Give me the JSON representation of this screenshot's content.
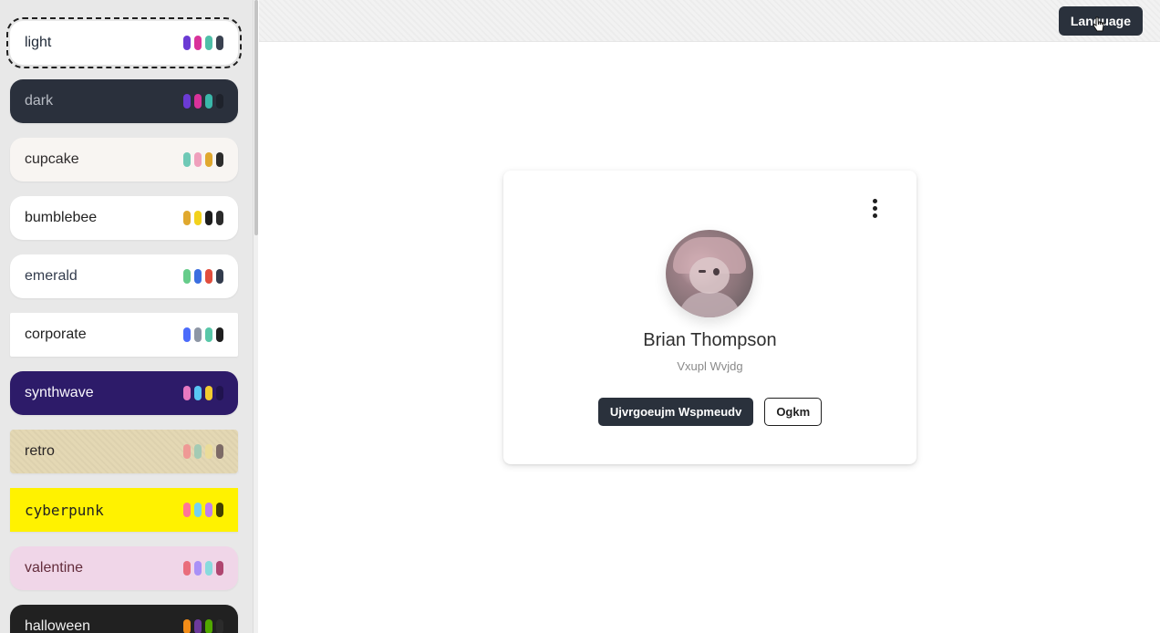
{
  "sidebar": {
    "themes": [
      {
        "label": "light",
        "bg": "#ffffff",
        "fg": "#1f2937",
        "swatches": [
          "#6b3bd4",
          "#d9329a",
          "#4fbfa8",
          "#3a4150"
        ]
      },
      {
        "label": "dark",
        "bg": "#2a303c",
        "fg": "#b8bcc4",
        "swatches": [
          "#6b3bd4",
          "#d9329a",
          "#3ab7a9",
          "#1e222b"
        ]
      },
      {
        "label": "cupcake",
        "bg": "#f8f5f2",
        "fg": "#2d2a2b",
        "swatches": [
          "#6fc9b6",
          "#ef9fbc",
          "#e0a82e",
          "#2d2d2d"
        ]
      },
      {
        "label": "bumblebee",
        "bg": "#ffffff",
        "fg": "#222222",
        "swatches": [
          "#e0a82e",
          "#f2d21c",
          "#1c1c1c",
          "#2b2b2b"
        ]
      },
      {
        "label": "emerald",
        "bg": "#ffffff",
        "fg": "#333c4d",
        "swatches": [
          "#66cc8a",
          "#3b6fe0",
          "#e14d3d",
          "#333c4d"
        ]
      },
      {
        "label": "corporate",
        "bg": "#ffffff",
        "fg": "#222222",
        "swatches": [
          "#4b6bfb",
          "#8d96a5",
          "#58c7a8",
          "#1f1f1f"
        ]
      },
      {
        "label": "synthwave",
        "bg": "#2d1b69",
        "fg": "#f9f7fd",
        "swatches": [
          "#e779c1",
          "#58c7f3",
          "#f3cc30",
          "#20134e"
        ]
      },
      {
        "label": "retro",
        "bg": "#e4d8b4",
        "fg": "#282425",
        "swatches": [
          "#ef9995",
          "#a4cbb4",
          "#ebdc99",
          "#7d6b66"
        ]
      },
      {
        "label": "cyberpunk",
        "bg": "#fff200",
        "fg": "#222222",
        "swatches": [
          "#ff7598",
          "#75d1f0",
          "#c07eec",
          "#423f00"
        ]
      },
      {
        "label": "valentine",
        "bg": "#f0d6e8",
        "fg": "#632c3b",
        "swatches": [
          "#e96d7b",
          "#a991f7",
          "#88dbdd",
          "#af4670"
        ]
      },
      {
        "label": "halloween",
        "bg": "#212121",
        "fg": "#f0f0f0",
        "swatches": [
          "#f28c18",
          "#6d3a9c",
          "#51a800",
          "#2b2b2b"
        ]
      }
    ]
  },
  "topbar": {
    "language_label": "Language"
  },
  "card": {
    "name": "Brian Thompson",
    "subtitle": "Vxupl Wvjdg",
    "primary_button": "Ujvrgoeujm Wspmeudv",
    "secondary_button": "Ogkm"
  }
}
